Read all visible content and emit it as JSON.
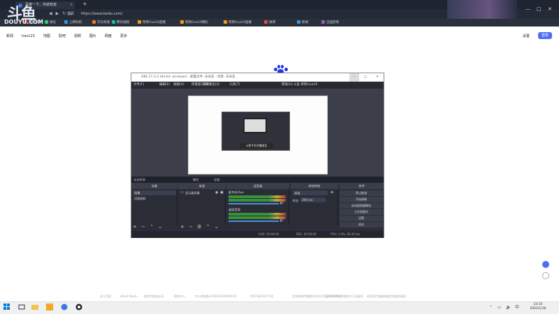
{
  "browser": {
    "tab_title": "百度一下，你就知道",
    "url": "https://www.baidu.com/",
    "home_label": "首页",
    "bookmarks": [
      "网址导航",
      "微信",
      "上网导航",
      "京东商城",
      "腾讯视频",
      "草原Gua10直播",
      "草原Gua10精彩",
      "草原Gua10直播",
      "微博",
      "新闻",
      "全国疫情"
    ]
  },
  "logo": {
    "main": "斗鱼",
    "sub": "DOUYU.COM"
  },
  "baidu": {
    "nav": [
      "新闻",
      "hao123",
      "地图",
      "贴吧",
      "视频",
      "图片",
      "网盘",
      "更多"
    ],
    "login": "设置",
    "login_button": "登录",
    "footer": [
      "关于百度",
      "About Baidu",
      "使用百度前必读",
      "帮助中心",
      "京公网安备11000002000001号",
      "京ICP证030173号",
      "信息网络传播视听节目许可证 0110516",
      "互联网宗教信息服务许可证编号",
      "药品医疗器械网络信息服务备案"
    ]
  },
  "obs": {
    "title": "OBS 27.2.0 (64-bit, windows) - 配置文件: 未命名 - 场景: 未命名",
    "menu": [
      "文件(F)",
      "编辑(E)",
      "视图(V)",
      "停靠窗口(D)",
      "场景集合(S)",
      "工具(T)",
      "帮助(H)",
      "斗鱼 草原Gua10"
    ],
    "preview_toast": "斗鱼平台开播成功",
    "scene_label": "未选择源",
    "scene_tabs": [
      "属性",
      "滤镜"
    ],
    "docks": {
      "scenes": {
        "title": "场景",
        "items": [
          "场景",
          "旧版相机"
        ]
      },
      "sources": {
        "title": "来源",
        "items": [
          "显示器采集"
        ]
      },
      "mixer": {
        "title": "混音器",
        "tracks": [
          "桌面音频",
          "麦克风/Aux"
        ]
      },
      "transitions": {
        "title": "转场特效",
        "type": "淡出",
        "duration_label": "时长",
        "duration": "300 ms"
      },
      "controls": {
        "title": "控件",
        "buttons": [
          "停止推流",
          "开始录制",
          "启动虚拟摄像机",
          "工作室模式",
          "设置",
          "退出"
        ]
      }
    },
    "status": {
      "live": "LIVE: 00:00:00",
      "rec": "REC: 00:00:00",
      "cpu": "CPU: 1.4%, 60.00 fps"
    }
  },
  "taskbar": {
    "time": "15:15",
    "date": "2022/1/16",
    "ime": "中"
  }
}
